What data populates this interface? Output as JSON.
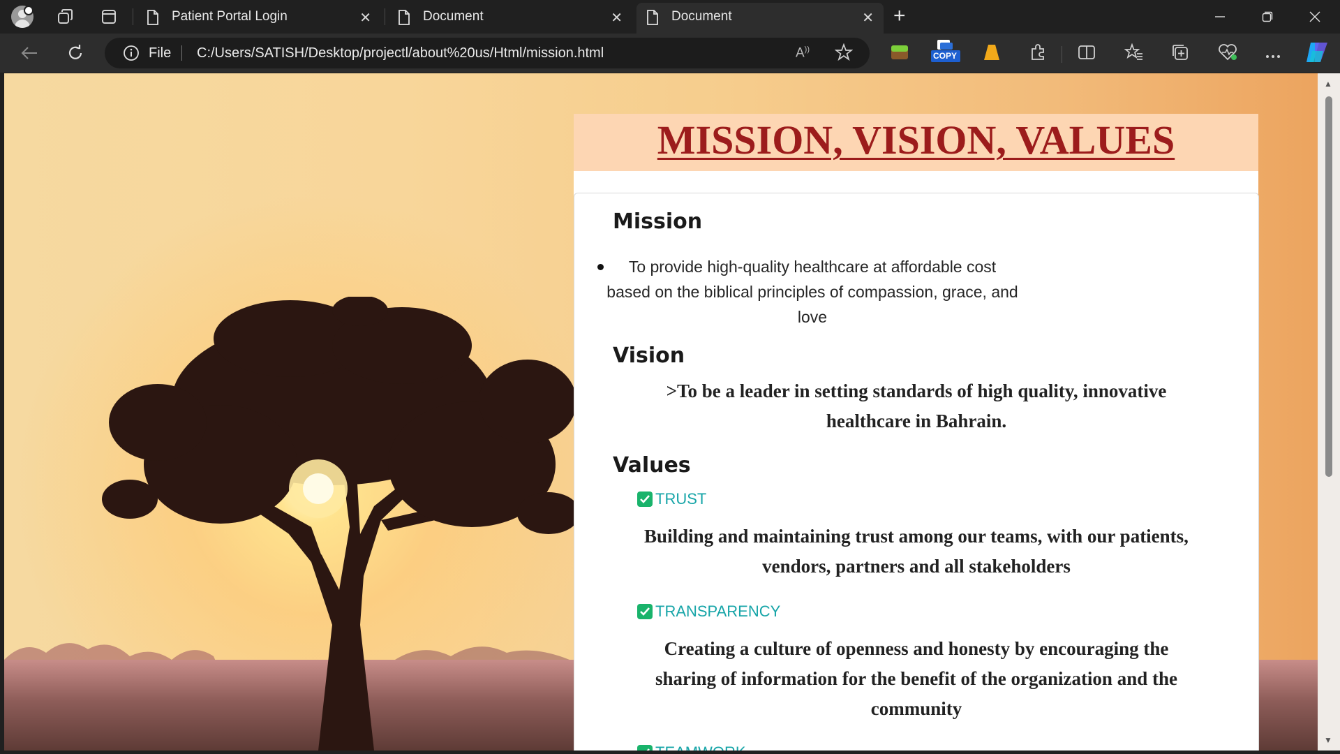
{
  "browser": {
    "tabs": [
      {
        "title": "Patient Portal Login"
      },
      {
        "title": "Document"
      },
      {
        "title": "Document"
      }
    ],
    "address": {
      "scheme_label": "File",
      "url": "C:/Users/SATISH/Desktop/projectl/about%20us/Html/mission.html"
    },
    "extensions": {
      "copy_label": "COPY"
    }
  },
  "page": {
    "title": "MISSION, VISION, VALUES",
    "mission": {
      "heading": "Mission",
      "text": "To provide high-quality healthcare at affordable cost based on the biblical principles of compassion, grace, and love"
    },
    "vision": {
      "heading": "Vision",
      "text": ">To be a leader in setting standards of high quality, innovative healthcare in Bahrain."
    },
    "values": {
      "heading": "Values",
      "items": [
        {
          "label": "TRUST",
          "text": "Building and maintaining trust among our teams, with our patients, vendors, partners and all stakeholders"
        },
        {
          "label": "TRANSPARENCY",
          "text": "Creating a culture of openness and honesty by encouraging the sharing of information for the benefit of the organization and the community"
        },
        {
          "label": "TEAMWORK"
        }
      ]
    }
  },
  "colors": {
    "title_red": "#9c1c1c",
    "title_band": "#fdd6b3",
    "value_label": "#17a5a8",
    "check_green": "#19b36b"
  }
}
